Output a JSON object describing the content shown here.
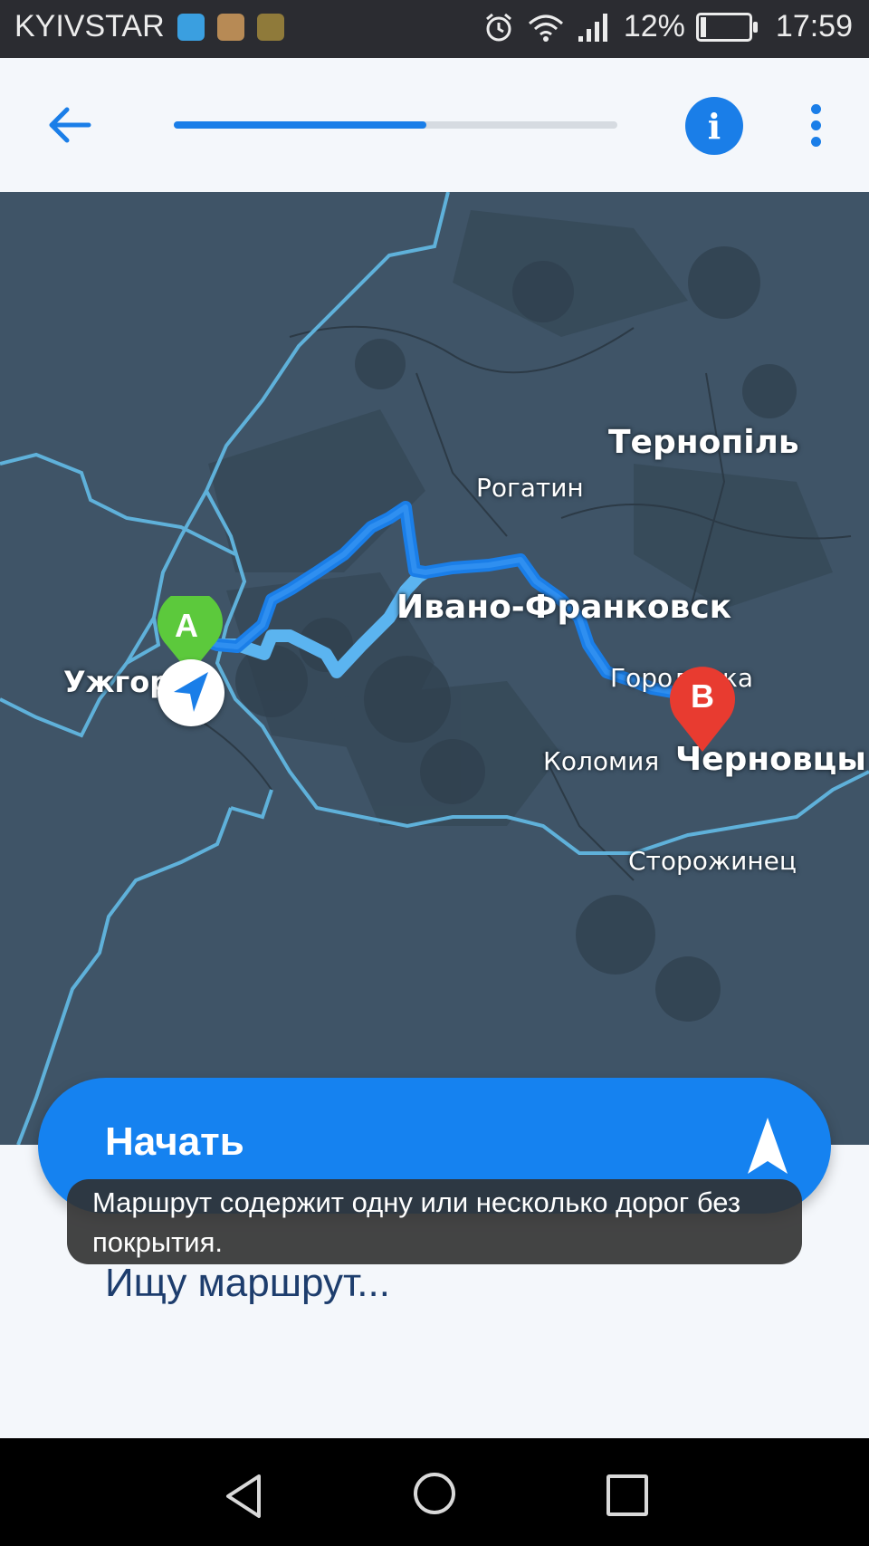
{
  "status_bar": {
    "carrier": "KYIVSTAR",
    "battery_percent": "12%",
    "time": "17:59",
    "icons": [
      "location-app-icon",
      "photo-app-icon",
      "image-app-icon",
      "alarm-icon",
      "wifi-icon",
      "signal-icon",
      "battery-icon"
    ]
  },
  "top_bar": {
    "back_icon": "arrow-left-icon",
    "route_progress": 0.57,
    "info_label": "i",
    "menu_icon": "more-vertical-icon"
  },
  "map": {
    "labels": {
      "ternopil": "Тернопіль",
      "rohatyn": "Рогатин",
      "ivano_frankivsk": "Ивано-Франковск",
      "uzhhorod": "Ужгород",
      "horodenka": "Городенка",
      "kolomyia": "Коломия",
      "chernivtsi": "Черновцы",
      "storozhynets": "Сторожинец"
    },
    "marker_a": "A",
    "marker_b": "B",
    "colors": {
      "route_primary": "#1a7ee8",
      "route_alt": "#5bb4f0",
      "marker_a": "#5cc93c",
      "marker_b": "#e83b30",
      "border": "#5fb1da"
    }
  },
  "actions": {
    "start_label": "Начать",
    "start_icon": "navigation-arrow-icon",
    "toast": "Маршрут содержит одну или несколько дорог без покрытия.",
    "searching": "Ищу маршрут..."
  },
  "system_nav": {
    "back_icon": "nav-back-icon",
    "home_icon": "nav-home-icon",
    "recent_icon": "nav-recent-icon"
  }
}
